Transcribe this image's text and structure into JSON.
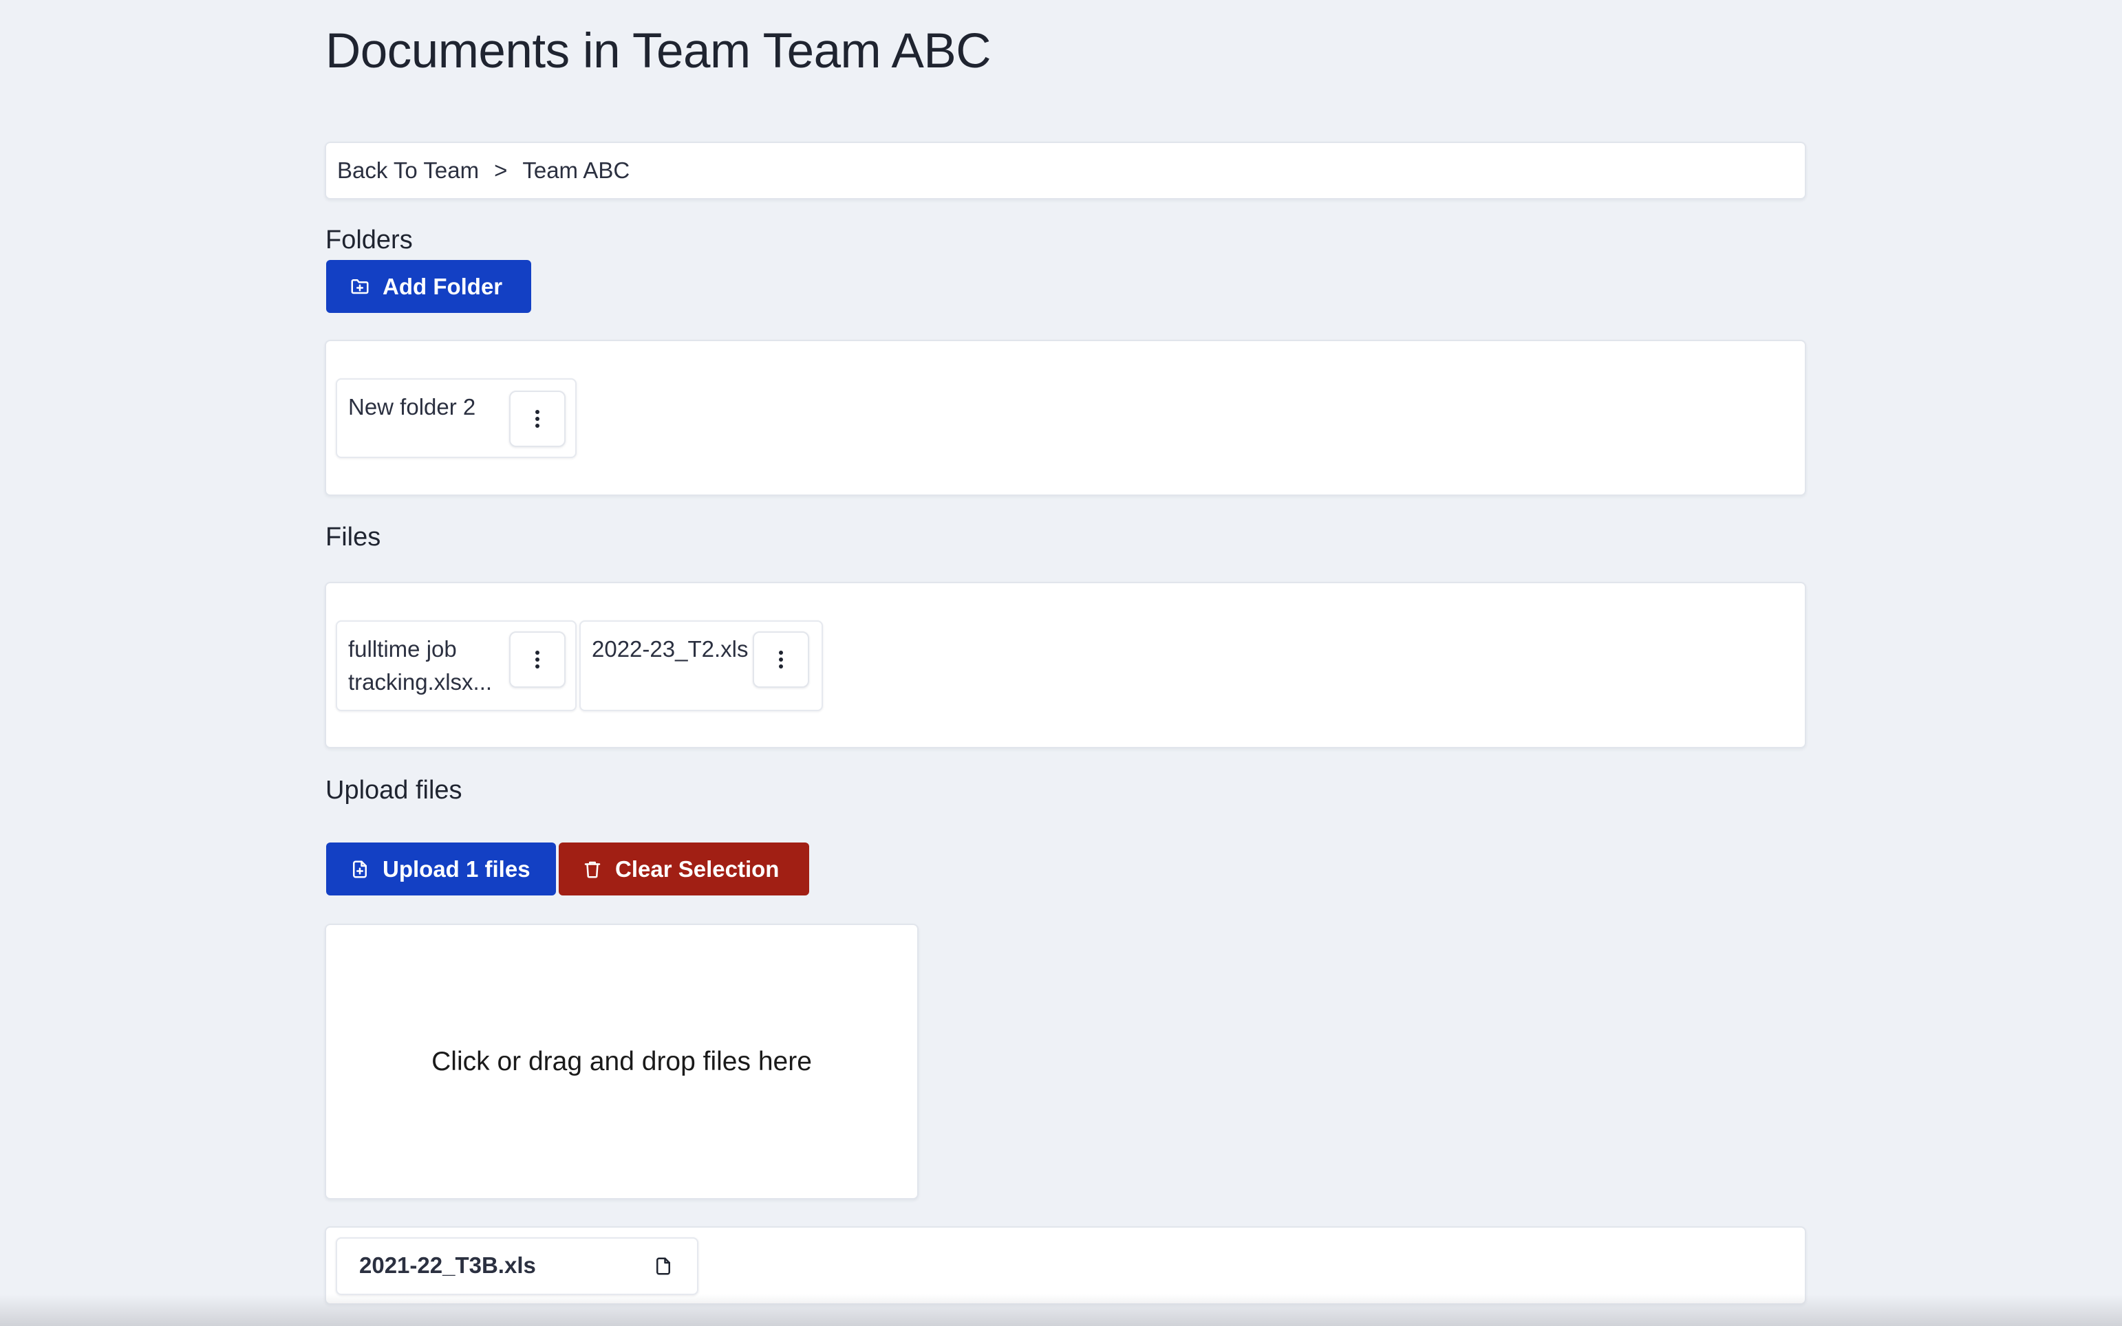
{
  "page": {
    "title": "Documents in Team Team ABC"
  },
  "breadcrumb": {
    "back_label": "Back To Team",
    "separator": ">",
    "current": "Team ABC"
  },
  "folders": {
    "heading": "Folders",
    "add_button_label": "Add Folder",
    "items": [
      {
        "name": "New folder 2"
      }
    ]
  },
  "files": {
    "heading": "Files",
    "items": [
      {
        "name_line1": "fulltime job",
        "name_line2": "tracking.xlsx..."
      },
      {
        "name_line1": "2022-23_T2.xls",
        "name_line2": ""
      }
    ]
  },
  "upload": {
    "heading": "Upload files",
    "upload_button_label": "Upload 1 files",
    "clear_button_label": "Clear Selection",
    "dropzone_text": "Click or drag and drop files here",
    "selected_files": [
      {
        "name": "2021-22_T3B.xls"
      }
    ]
  },
  "colors": {
    "background": "#eef1f6",
    "primary_button": "#1340c4",
    "danger_button": "#a11f14",
    "card": "#ffffff"
  },
  "icons": {
    "add_folder": "folder-plus-icon",
    "upload": "file-plus-icon",
    "clear": "trash-icon",
    "more": "more-vertical-icon",
    "selected_file": "file-icon"
  }
}
